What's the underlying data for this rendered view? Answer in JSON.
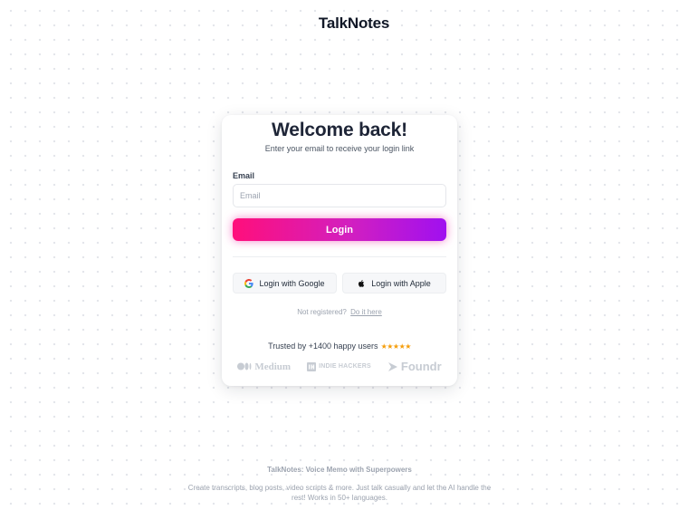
{
  "app": {
    "name": "TalkNotes"
  },
  "login": {
    "title": "Welcome back!",
    "subtitle": "Enter your email to receive your login link",
    "email_label": "Email",
    "email_placeholder": "Email",
    "email_value": "",
    "login_button": "Login",
    "google_button": "Login with Google",
    "apple_button": "Login with Apple",
    "not_registered": "Not registered?",
    "register_link": "Do it here"
  },
  "social_proof": {
    "trusted_text": "Trusted by +1400 happy users",
    "rating_stars": "★★★★★",
    "brands": [
      "Medium",
      "INDIE HACKERS",
      "Foundr"
    ]
  },
  "footer": {
    "title": "TalkNotes: Voice Memo with Superpowers",
    "description_line1": "Create transcripts, blog posts, video scripts & more. Just talk casually and let the AI handle the",
    "description_line2": "rest! Works in 50+ languages."
  },
  "colors": {
    "accent_start": "#ff0f7b",
    "accent_end": "#a010f0",
    "star": "#f59e0b"
  },
  "icons": [
    "waveform-logo-icon",
    "google-icon",
    "apple-icon",
    "star-icon",
    "medium-icon",
    "indie-hackers-icon",
    "foundr-icon"
  ]
}
